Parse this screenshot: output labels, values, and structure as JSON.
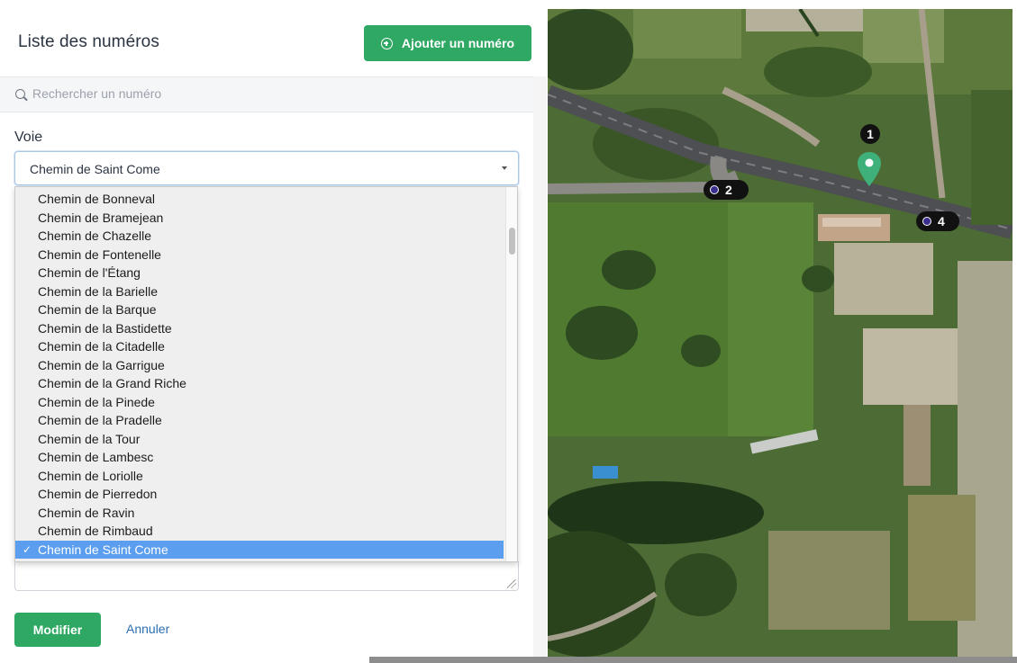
{
  "sidebar": {
    "title": "Liste des numéros",
    "add_button_label": "Ajouter un numéro",
    "search_placeholder": "Rechercher un numéro",
    "voie_label": "Voie",
    "selected_voie": "Chemin de Saint Come",
    "options": [
      "Chemin de Bonneval",
      "Chemin de Bramejean",
      "Chemin de Chazelle",
      "Chemin de Fontenelle",
      "Chemin de l'Étang",
      "Chemin de la Barielle",
      "Chemin de la Barque",
      "Chemin de la Bastidette",
      "Chemin de la Citadelle",
      "Chemin de la Garrigue",
      "Chemin de la Grand Riche",
      "Chemin de la Pinede",
      "Chemin de la Pradelle",
      "Chemin de la Tour",
      "Chemin de Lambesc",
      "Chemin de Loriolle",
      "Chemin de Pierredon",
      "Chemin de Ravin",
      "Chemin de Rimbaud",
      "Chemin de Saint Come"
    ],
    "selected_index": 19,
    "modify_label": "Modifier",
    "cancel_label": "Annuler"
  },
  "map": {
    "markers": [
      {
        "label": "1",
        "type": "pin",
        "color": "#3fb07a"
      },
      {
        "label": "2",
        "type": "circle"
      },
      {
        "label": "4",
        "type": "circle"
      }
    ]
  },
  "colors": {
    "primary_green": "#2fa863",
    "selection_blue": "#5b9ef0",
    "link_blue": "#2d6fb3"
  }
}
